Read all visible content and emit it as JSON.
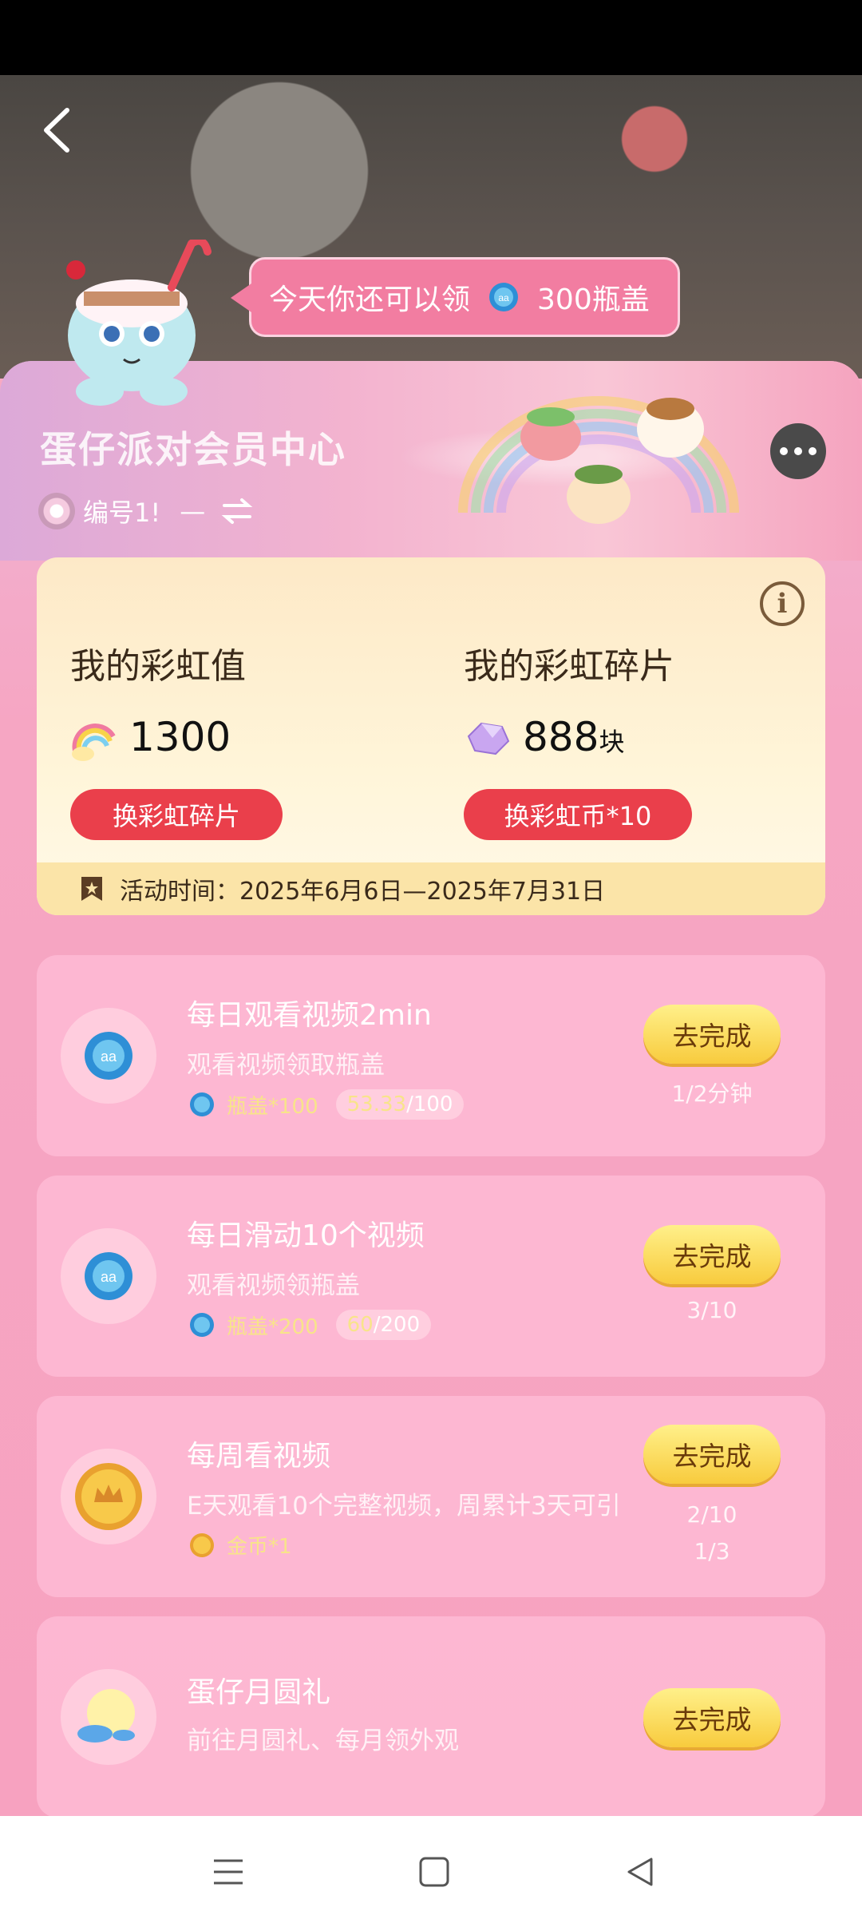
{
  "bubble": {
    "prefix": "今天你还可以领",
    "amount": "300瓶盖"
  },
  "header": {
    "title": "蛋仔派对会员中心",
    "user_label": "编号1!",
    "separator": "—"
  },
  "points": {
    "rainbow_value": {
      "label": "我的彩虹值",
      "value": "1300",
      "button": "换彩虹碎片"
    },
    "rainbow_shard": {
      "label": "我的彩虹碎片",
      "value": "888",
      "unit": "块",
      "button": "换彩虹币*10"
    },
    "activity_time": "活动时间：2025年6月6日—2025年7月31日"
  },
  "tasks": [
    {
      "title": "每日观看视频2min",
      "desc": "观看视频领取瓶盖",
      "reward_label": "瓶盖*100",
      "progress_current": "53.33",
      "progress_total": "/100",
      "button": "去完成",
      "status": "1/2分钟"
    },
    {
      "title": "每日滑动10个视频",
      "desc": "观看视频领瓶盖",
      "reward_label": "瓶盖*200",
      "progress_current": "60",
      "progress_total": "/200",
      "button": "去完成",
      "status": "3/10"
    },
    {
      "title": "每周看视频",
      "desc": "E天观看10个完整视频，周累计3天可引",
      "reward_label": "金币*1",
      "button": "去完成",
      "status_line1": "2/10",
      "status_line2": "1/3"
    },
    {
      "title": "蛋仔月圆礼",
      "desc": "前往月圆礼、每月领外观",
      "button": "去完成"
    }
  ],
  "colors": {
    "accent_red": "#ea3f4b",
    "panel_pink": "#f7a2c0",
    "button_yellow": "#f8cb3d",
    "card_cream": "#fff5d9"
  }
}
